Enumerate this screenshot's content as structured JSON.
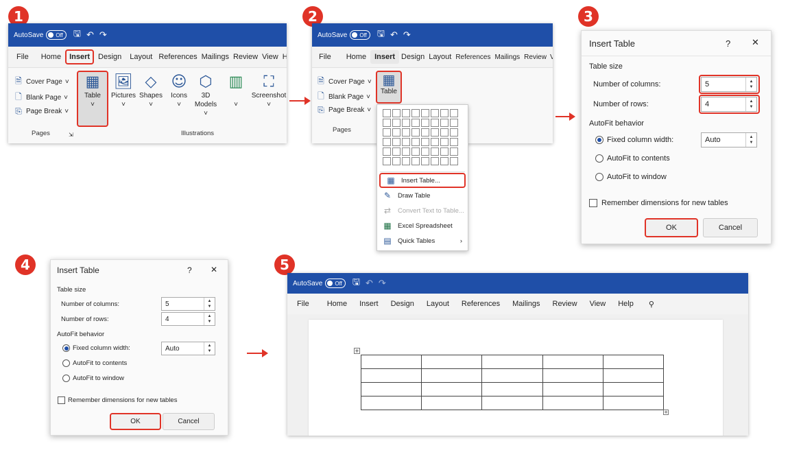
{
  "steps": [
    "1",
    "2",
    "3",
    "4",
    "5"
  ],
  "window": {
    "autosave_label": "AutoSave",
    "autosave_state": "Off"
  },
  "menu_full": [
    "File",
    "Home",
    "Insert",
    "Design",
    "Layout",
    "References",
    "Mailings",
    "Review",
    "View",
    "Help"
  ],
  "panel1": {
    "ribbon_small": [
      "Cover Page",
      "Blank Page",
      "Page Break"
    ],
    "table_label": "Table",
    "big_buttons": [
      "Pictures",
      "Shapes",
      "Icons",
      "3D\nModels",
      "Screenshot"
    ],
    "group_pages": "Pages",
    "group_illustrations": "Illustrations"
  },
  "panel2": {
    "table_label": "Table",
    "group_pages": "Pages",
    "menu_items": [
      "Insert Table...",
      "Draw Table",
      "Convert Text to Table...",
      "Excel Spreadsheet",
      "Quick Tables"
    ]
  },
  "dialog": {
    "title": "Insert Table",
    "help": "?",
    "close": "✕",
    "table_size": "Table size",
    "cols_label": "Number of columns:",
    "rows_label": "Number of rows:",
    "cols_value": "5",
    "rows_value": "4",
    "autofit_label": "AutoFit behavior",
    "fixed_label": "Fixed column width:",
    "fixed_value": "Auto",
    "contents_label": "AutoFit to contents",
    "window_label": "AutoFit to window",
    "remember_label": "Remember dimensions for new tables",
    "ok": "OK",
    "cancel": "Cancel"
  },
  "colors": {
    "accent": "#e03327",
    "titlebar": "#1f4fa8"
  }
}
